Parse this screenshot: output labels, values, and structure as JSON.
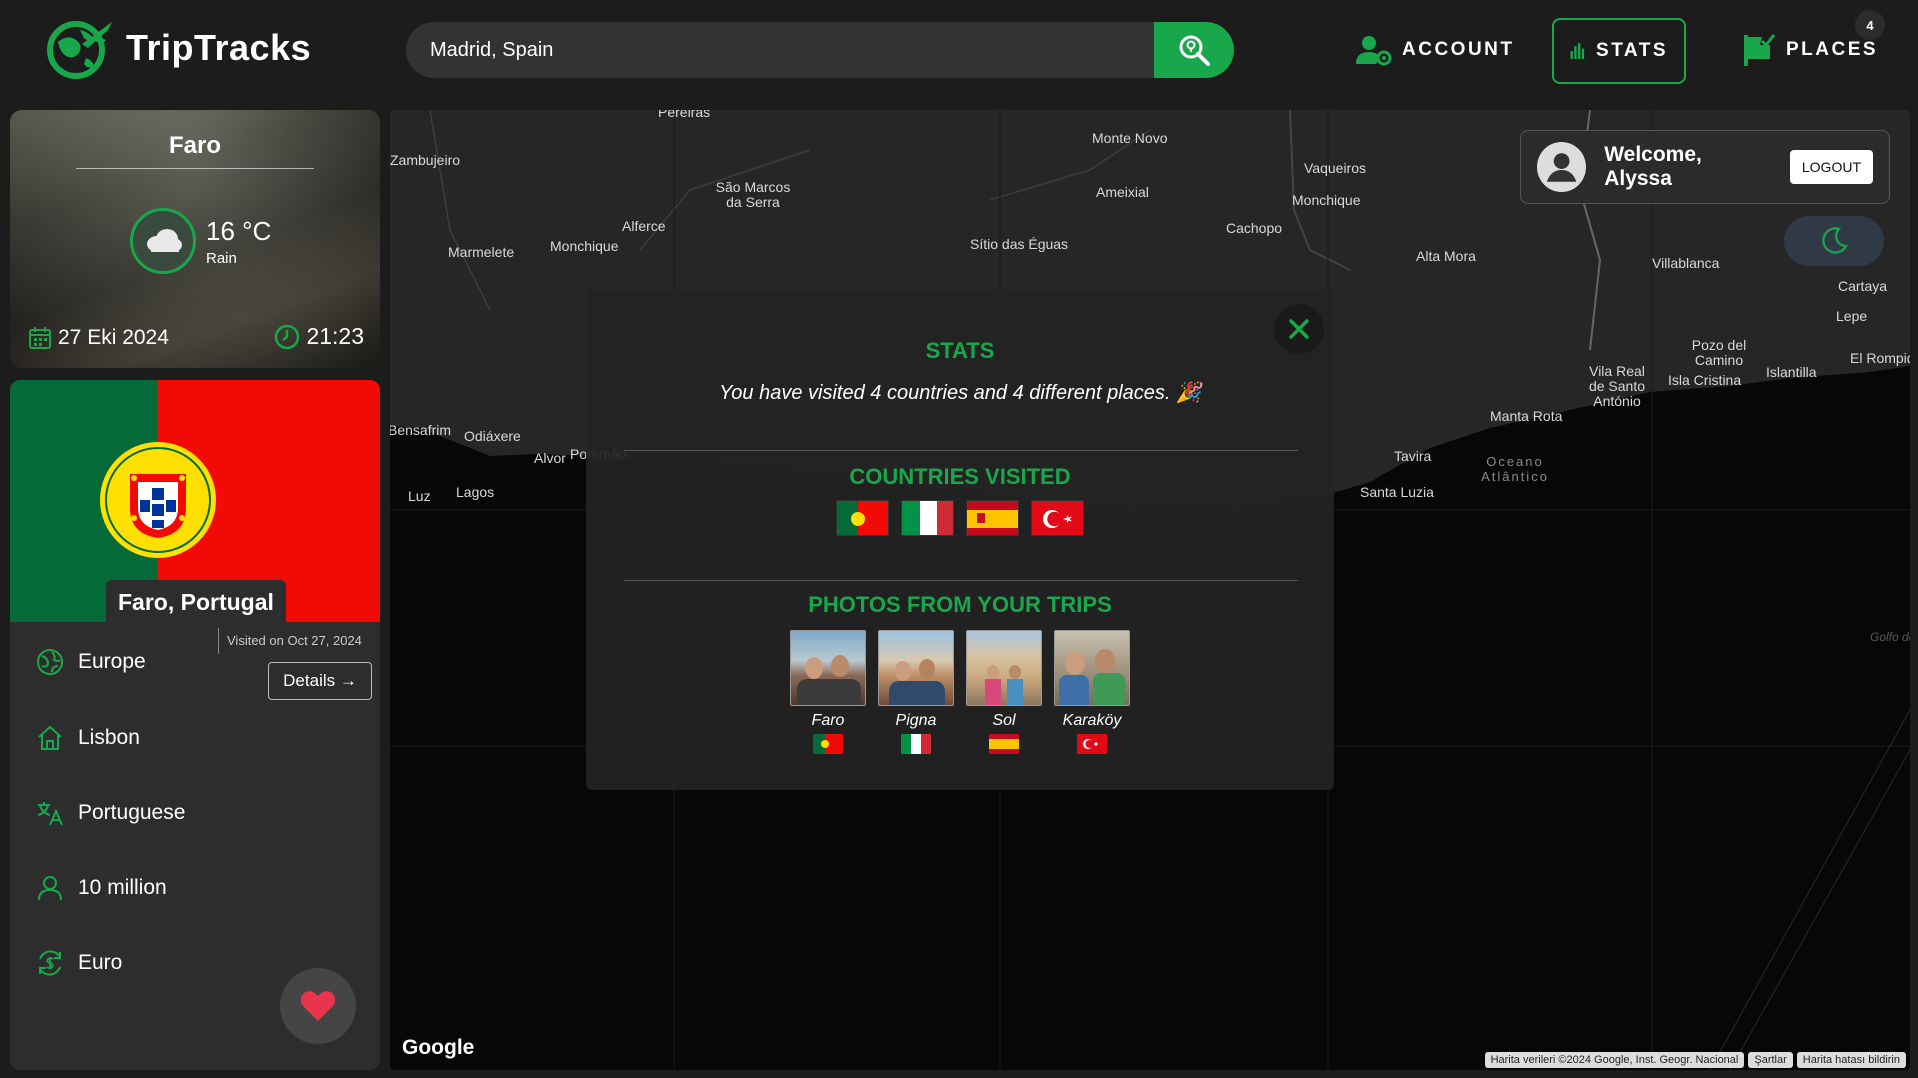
{
  "header": {
    "app_name": "TripTracks",
    "search_value": "Madrid, Spain",
    "nav": [
      {
        "label": "ACCOUNT",
        "icon": "user-gear-icon"
      },
      {
        "label": "STATS",
        "icon": "bar-chart-icon"
      },
      {
        "label": "PLACES",
        "icon": "flag-check-icon",
        "badge": "4"
      }
    ]
  },
  "weather": {
    "city": "Faro",
    "temperature": "16 °C",
    "condition": "Rain",
    "date": "27 Eki 2024",
    "time": "21:23"
  },
  "country": {
    "place": "Faro, Portugal",
    "visited_on": "Visited on Oct 27, 2024",
    "details_label": "Details →",
    "continent": "Europe",
    "capital": "Lisbon",
    "language": "Portuguese",
    "population": "10 million",
    "currency": "Euro"
  },
  "user": {
    "welcome": "Welcome, Alyssa",
    "logout_label": "LOGOUT"
  },
  "map": {
    "provider": "Google",
    "attribution": [
      "Harita verileri ©2024 Google, Inst. Geogr. Nacional",
      "Şartlar",
      "Harita hatası bildirin"
    ],
    "labels": [
      "Pereiras",
      "Zambujeiro",
      "São Marcos da Serra",
      "Monte Novo",
      "Vaqueiros",
      "Ameixial",
      "Monchique",
      "Alferce",
      "Marmelete",
      "Monchique",
      "Sítio das Éguas",
      "Cachopo",
      "Alta Mora",
      "Villablanca",
      "Cartaya",
      "Lepe",
      "El Rompido",
      "Pozo del Camino",
      "Islantilla",
      "Vila Real de Santo António",
      "Isla Cristina",
      "Manta Rota",
      "Bensafrim",
      "Odiáxere",
      "Alvor",
      "Portimão",
      "Luz",
      "Lagos",
      "Tavira",
      "Oceano Atlântico",
      "Santa Luzia",
      "Golfo de Cádiz"
    ]
  },
  "stats": {
    "title": "STATS",
    "summary": "You have visited 4 countries and 4 different places. 🎉",
    "countries_title": "COUNTRIES VISITED",
    "countries": [
      "Portugal",
      "Italy",
      "Spain",
      "Turkey"
    ],
    "photos_title": "PHOTOS FROM YOUR TRIPS",
    "photos": [
      {
        "caption": "Faro",
        "country": "Portugal"
      },
      {
        "caption": "Pigna",
        "country": "Italy"
      },
      {
        "caption": "Sol",
        "country": "Spain"
      },
      {
        "caption": "Karaköy",
        "country": "Turkey"
      }
    ]
  },
  "colors": {
    "accent": "#18a84b",
    "background": "#1c1c1c",
    "panel": "#2d2d2d"
  }
}
